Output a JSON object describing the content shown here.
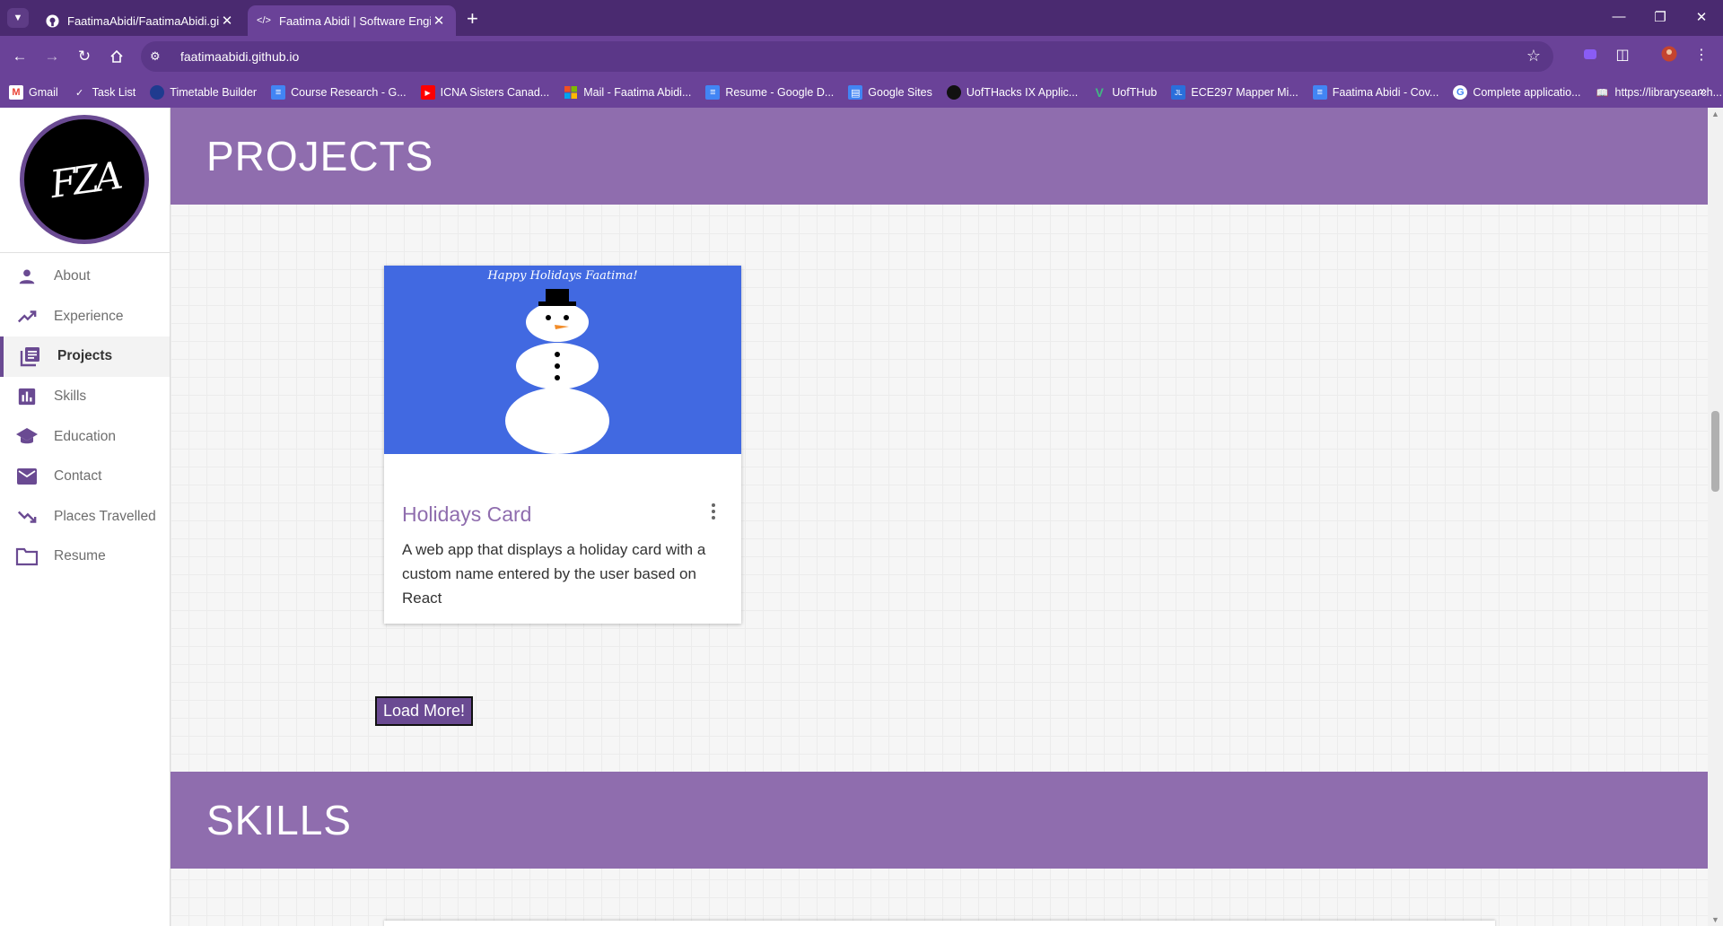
{
  "browser": {
    "tabs": [
      {
        "title": "FaatimaAbidi/FaatimaAbidi.gith",
        "icon": "github-icon",
        "active": false
      },
      {
        "title": "Faatima Abidi | Software Engine",
        "icon": "code-icon",
        "active": true
      }
    ],
    "url": "faatimaabidi.github.io",
    "bookmarks": [
      {
        "label": "Gmail",
        "icon": "gmail-icon",
        "color": "#ea4335"
      },
      {
        "label": "Task List",
        "icon": "check-icon",
        "color": "#ffffff"
      },
      {
        "label": "Timetable Builder",
        "icon": "timetable-icon",
        "color": "#1f3b8f"
      },
      {
        "label": "Course Research - G...",
        "icon": "docs-icon",
        "color": "#4285f4"
      },
      {
        "label": "ICNA Sisters Canad...",
        "icon": "youtube-icon",
        "color": "#ff0000"
      },
      {
        "label": "Mail - Faatima Abidi...",
        "icon": "microsoft-icon",
        "color": "#f25022"
      },
      {
        "label": "Resume - Google D...",
        "icon": "docs-icon",
        "color": "#4285f4"
      },
      {
        "label": "Google Sites",
        "icon": "sites-icon",
        "color": "#4285f4"
      },
      {
        "label": "UofTHacks IX Applic...",
        "icon": "circle-icon",
        "color": "#111111"
      },
      {
        "label": "UofTHub",
        "icon": "vue-icon",
        "color": "#41b883"
      },
      {
        "label": "ECE297 Mapper Mi...",
        "icon": "jl-icon",
        "color": "#2a6fdb"
      },
      {
        "label": "Faatima Abidi - Cov...",
        "icon": "docs-icon",
        "color": "#4285f4"
      },
      {
        "label": "Complete applicatio...",
        "icon": "google-icon",
        "color": "#ffffff"
      },
      {
        "label": "https://librarysearch...",
        "icon": "book-icon",
        "color": "#cccccc"
      }
    ]
  },
  "logo_text": "FZA",
  "nav": [
    {
      "label": "About",
      "icon": "person-icon"
    },
    {
      "label": "Experience",
      "icon": "trending-up-icon"
    },
    {
      "label": "Projects",
      "icon": "library-books-icon",
      "active": true
    },
    {
      "label": "Skills",
      "icon": "bar-chart-icon"
    },
    {
      "label": "Education",
      "icon": "school-icon"
    },
    {
      "label": "Contact",
      "icon": "mail-icon"
    },
    {
      "label": "Places Travelled",
      "icon": "trending-down-icon"
    },
    {
      "label": "Resume",
      "icon": "folder-icon"
    }
  ],
  "sections": {
    "projects_title": "PROJECTS",
    "skills_title": "SKILLS"
  },
  "projects": [
    {
      "image_caption": "Happy Holidays Faatima!",
      "title": "Holidays Card",
      "description": "A web app that displays a holiday card with a custom name entered by the user based on React"
    }
  ],
  "load_more_label": "Load More!",
  "colors": {
    "accent": "#8f6dae",
    "accent_dark": "#6a4a92",
    "chrome": "#6a4298",
    "card_image_bg": "#4169e1"
  }
}
